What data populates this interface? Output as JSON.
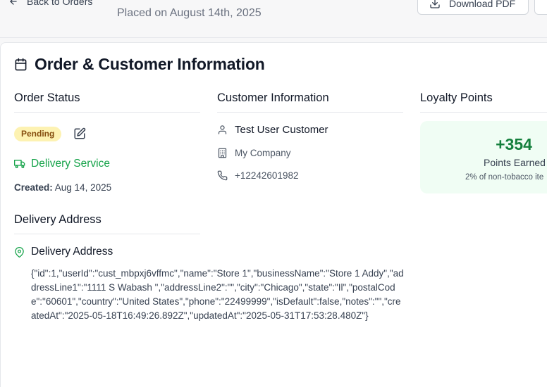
{
  "header": {
    "back_label": "Back to Orders",
    "placed_text": "Placed on August 14th, 2025",
    "download_label": "Download PDF"
  },
  "card": {
    "title": "Order & Customer Information"
  },
  "order_status": {
    "heading": "Order Status",
    "status_badge": "Pending",
    "delivery_method": "Delivery Service",
    "created_label": "Created:",
    "created_value": "Aug 14, 2025"
  },
  "delivery_address": {
    "heading": "Delivery Address",
    "label": "Delivery Address",
    "raw": "{\"id\":1,\"userId\":\"cust_mbpxj6vffmc\",\"name\":\"Store 1\",\"businessName\":\"Store 1 Addy\",\"addressLine1\":\"1111 S Wabash \",\"addressLine2\":\"\",\"city\":\"Chicago\",\"state\":\"Il\",\"postalCode\":\"60601\",\"country\":\"United States\",\"phone\":\"22499999\",\"isDefault\":false,\"notes\":\"\",\"createdAt\":\"2025-05-18T16:49:26.892Z\",\"updatedAt\":\"2025-05-31T17:53:28.480Z\"}"
  },
  "customer": {
    "heading": "Customer Information",
    "name": "Test User Customer",
    "company": "My Company",
    "phone": "+12242601982"
  },
  "loyalty": {
    "heading": "Loyalty Points",
    "points": "+354",
    "points_label": "Points Earned",
    "note": "2% of non-tobacco ite"
  },
  "colors": {
    "accent_green": "#16a34a",
    "badge_yellow": "#fdf2b2"
  }
}
